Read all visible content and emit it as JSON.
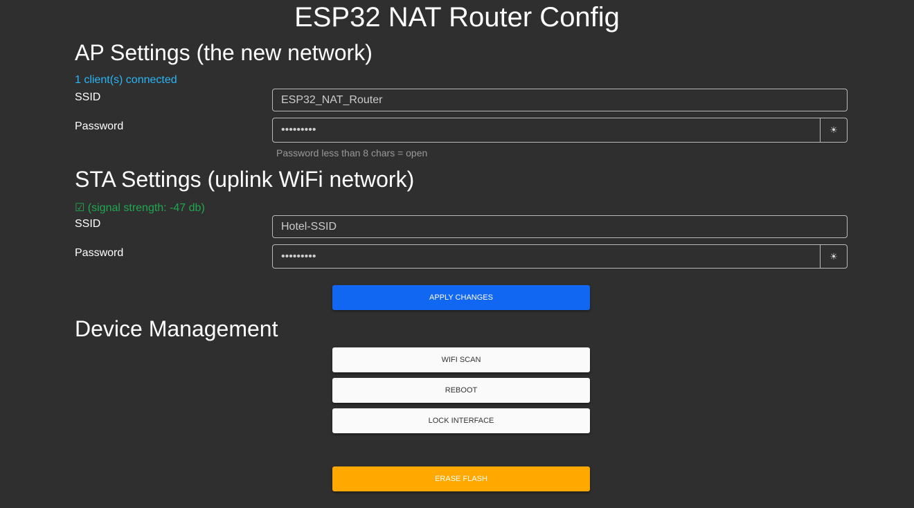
{
  "title": "ESP32 NAT Router Config",
  "ap": {
    "heading": "AP Settings (the new network)",
    "status": "1 client(s) connected",
    "ssid_label": "SSID",
    "ssid_value": "ESP32_NAT_Router",
    "password_label": "Password",
    "password_value": "•••••••••",
    "hint": "Password less than 8 chars = open",
    "toggle_icon": "☀"
  },
  "sta": {
    "heading": "STA Settings (uplink WiFi network)",
    "status": "☑ (signal strength: -47 db)",
    "ssid_label": "SSID",
    "ssid_value": "Hotel-SSID",
    "password_label": "Password",
    "password_value": "•••••••••",
    "toggle_icon": "☀"
  },
  "apply_label": "APPLY CHANGES",
  "device": {
    "heading": "Device Management",
    "wifi_scan": "WIFI SCAN",
    "reboot": "REBOOT",
    "lock": "LOCK INTERFACE",
    "erase": "ERASE FLASH"
  },
  "colors": {
    "background": "#2f2f2f",
    "primary": "#1167f2",
    "warning": "#ffa800",
    "info": "#29b6f6",
    "success": "#1fa84f"
  }
}
